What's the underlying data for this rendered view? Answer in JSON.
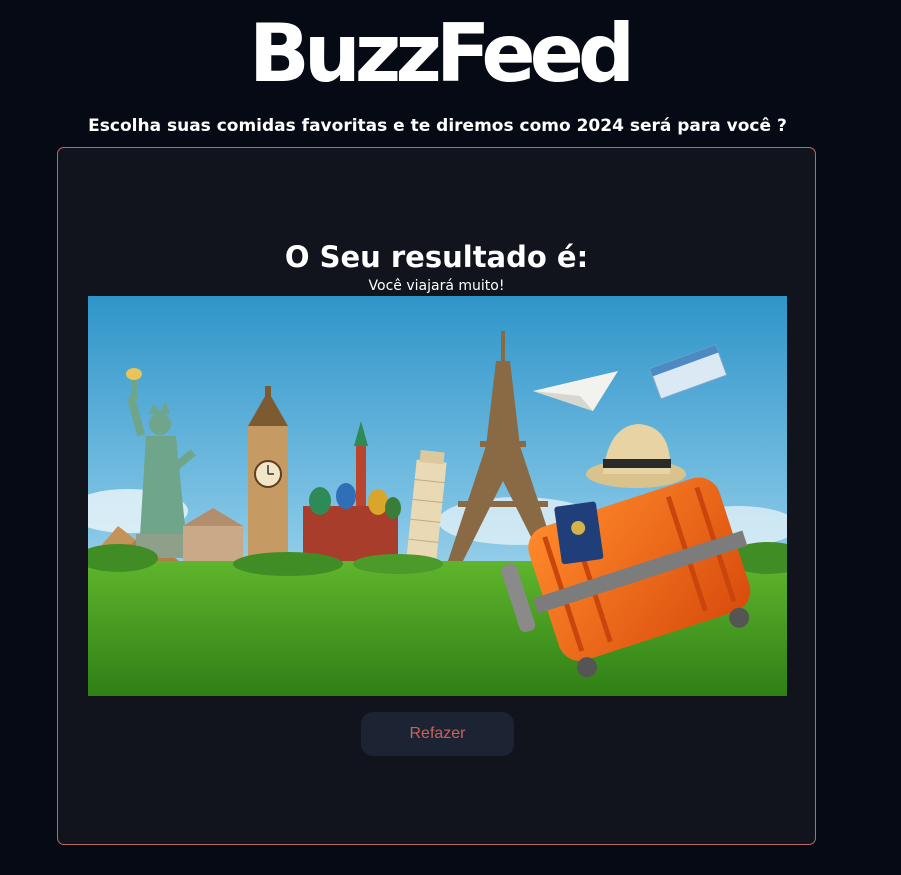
{
  "header": {
    "logo_text": "BuzzFeed",
    "subtitle": "Escolha suas comidas favoritas e te diremos como 2024 será para você ?"
  },
  "result": {
    "title": "O Seu resultado é:",
    "text": "Você viajará muito!",
    "image_icon": "travel-landmarks-suitcase-image"
  },
  "actions": {
    "redo_label": "Refazer"
  },
  "colors": {
    "page_background": "#050a14",
    "card_background": "#11141d",
    "card_border": "#b86a66",
    "button_background": "#1c2433",
    "button_text": "#c9625e"
  }
}
